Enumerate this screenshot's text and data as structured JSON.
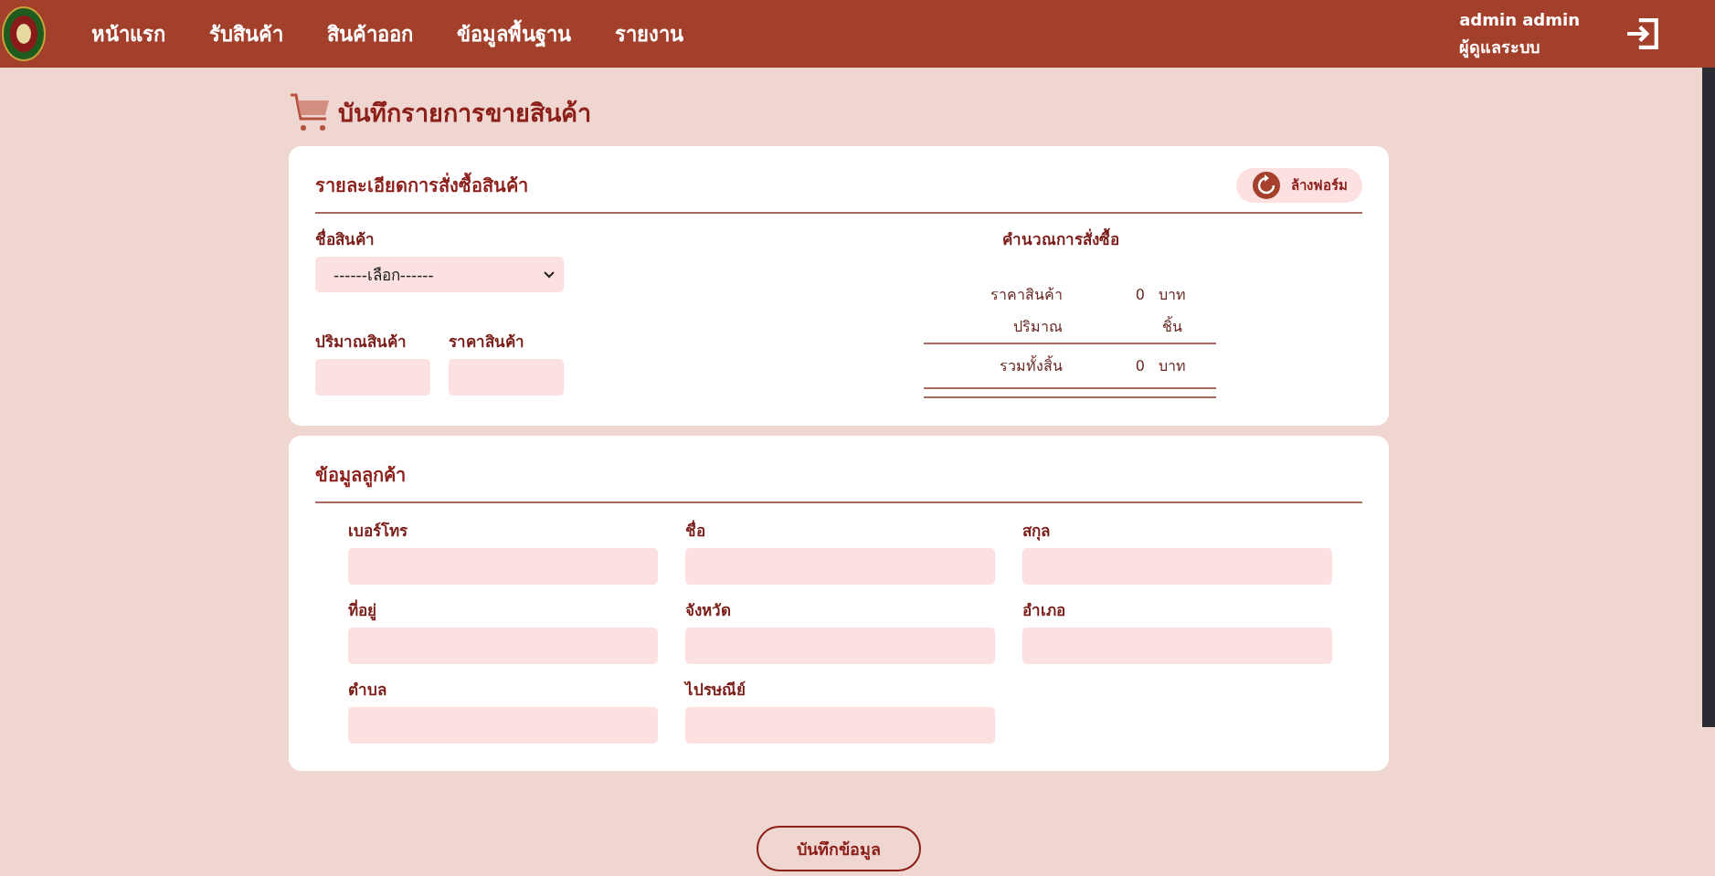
{
  "nav": {
    "items": [
      {
        "label": "หน้าแรก"
      },
      {
        "label": "รับสินค้า"
      },
      {
        "label": "สินค้าออก"
      },
      {
        "label": "ข้อมูลพื้นฐาน"
      },
      {
        "label": "รายงาน"
      }
    ]
  },
  "user": {
    "name": "admin admin",
    "role": "ผู้ดูแลระบบ"
  },
  "page_title": "บันทึกรายการขายสินค้า",
  "order_card": {
    "title": "รายละเอียดการสั่งซื้อสินค้า",
    "reset_button": "ล้างฟอร์ม",
    "product_field": {
      "label": "ชื่อสินค้า",
      "value": "------เลือก------"
    },
    "quantity_field": {
      "label": "ปริมาณสินค้า"
    },
    "price_field": {
      "label": "ราคาสินค้า"
    },
    "summary": {
      "title": "คำนวณการสั่งซื้อ",
      "rows": [
        {
          "label": "ราคาสินค้า",
          "value": "0",
          "unit": "บาท"
        },
        {
          "label": "ปริมาณ",
          "unit": "ชิ้น"
        }
      ],
      "total": {
        "label": "รวมทั้งสิ้น",
        "value": "0",
        "unit": "บาท"
      }
    }
  },
  "customer_card": {
    "title": "ข้อมูลลูกค้า",
    "fields": [
      {
        "label": "เบอร์โทร"
      },
      {
        "label": "ชื่อ"
      },
      {
        "label": "สกุล"
      },
      {
        "label": "ที่อยู่"
      },
      {
        "label": "จังหวัด"
      },
      {
        "label": "อำเภอ"
      },
      {
        "label": "ตำบล"
      },
      {
        "label": "ไปรษณีย์"
      }
    ]
  },
  "save_button": "บันทึกข้อมูล"
}
